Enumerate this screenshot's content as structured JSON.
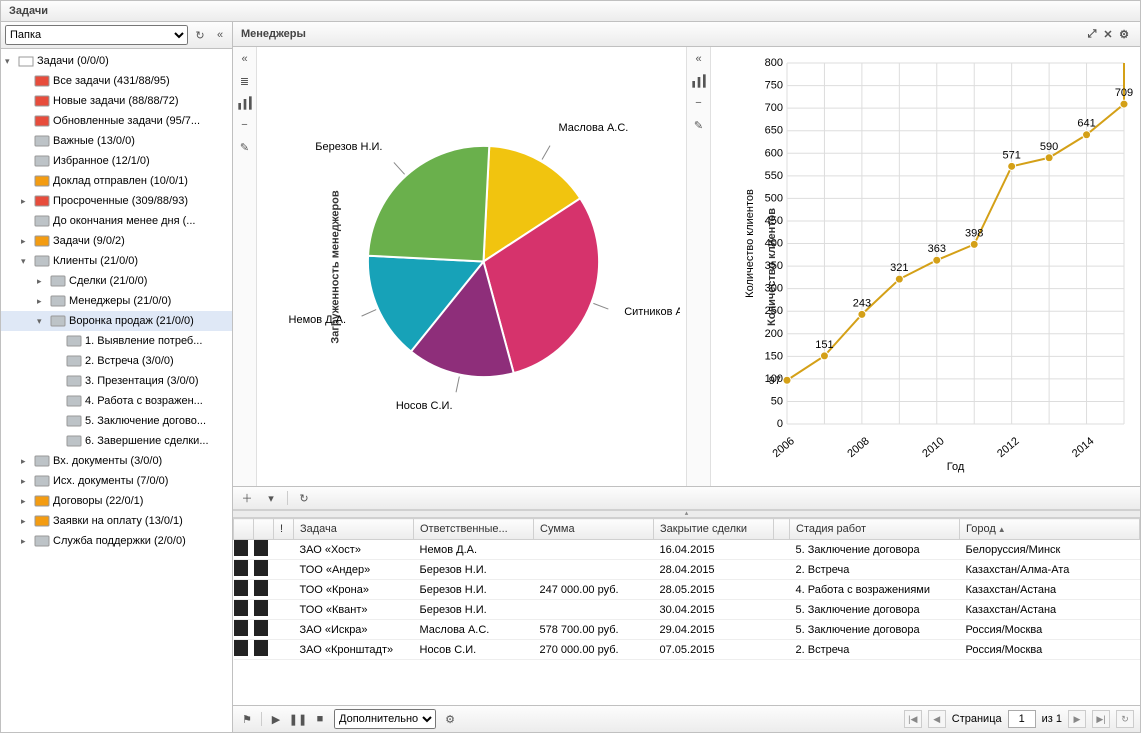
{
  "title": "Задачи",
  "sidebar": {
    "folder_select": "Папка",
    "root": {
      "label": "Задачи (0/0/0)"
    },
    "items": [
      {
        "icon": "red",
        "label": "Все задачи (431/88/95)",
        "indent": 1
      },
      {
        "icon": "red",
        "label": "Новые задачи (88/88/72)",
        "indent": 1
      },
      {
        "icon": "red",
        "label": "Обновленные задачи (95/7...",
        "indent": 1
      },
      {
        "icon": "grey",
        "label": "Важные (13/0/0)",
        "indent": 1
      },
      {
        "icon": "grey",
        "label": "Избранное (12/1/0)",
        "indent": 1
      },
      {
        "icon": "yellow",
        "label": "Доклад отправлен (10/0/1)",
        "indent": 1
      },
      {
        "icon": "red",
        "label": "Просроченные (309/88/93)",
        "indent": 1,
        "arrow": "collapsed"
      },
      {
        "icon": "grey",
        "label": "До окончания менее дня (...",
        "indent": 1
      },
      {
        "icon": "yellow",
        "label": "Задачи (9/0/2)",
        "indent": 1,
        "arrow": "collapsed"
      },
      {
        "icon": "grey",
        "label": "Клиенты (21/0/0)",
        "indent": 1,
        "arrow": "expanded"
      },
      {
        "icon": "grey",
        "label": "Сделки (21/0/0)",
        "indent": 2,
        "arrow": "collapsed"
      },
      {
        "icon": "grey",
        "label": "Менеджеры (21/0/0)",
        "indent": 2,
        "arrow": "collapsed"
      },
      {
        "icon": "grey",
        "label": "Воронка продаж (21/0/0)",
        "indent": 2,
        "arrow": "expanded",
        "selected": true
      },
      {
        "icon": "grey",
        "label": "1. Выявление потреб...",
        "indent": 3
      },
      {
        "icon": "grey",
        "label": "2. Встреча (3/0/0)",
        "indent": 3
      },
      {
        "icon": "grey",
        "label": "3. Презентация (3/0/0)",
        "indent": 3
      },
      {
        "icon": "grey",
        "label": "4. Работа с возражен...",
        "indent": 3
      },
      {
        "icon": "grey",
        "label": "5. Заключение догово...",
        "indent": 3
      },
      {
        "icon": "grey",
        "label": "6. Завершение сделки...",
        "indent": 3
      },
      {
        "icon": "grey",
        "label": "Вх. документы (3/0/0)",
        "indent": 1,
        "arrow": "collapsed"
      },
      {
        "icon": "grey",
        "label": "Исх. документы (7/0/0)",
        "indent": 1,
        "arrow": "collapsed"
      },
      {
        "icon": "yellow",
        "label": "Договоры (22/0/1)",
        "indent": 1,
        "arrow": "collapsed"
      },
      {
        "icon": "yellow",
        "label": "Заявки на оплату (13/0/1)",
        "indent": 1,
        "arrow": "collapsed"
      },
      {
        "icon": "grey",
        "label": "Служба поддержки (2/0/0)",
        "indent": 1,
        "arrow": "collapsed"
      }
    ]
  },
  "content": {
    "title": "Менеджеры"
  },
  "pie_vlabel": "Загруженность менеджеров",
  "line_vlabel": "Количество клиентов",
  "chart_data": [
    {
      "type": "pie",
      "title": "Загруженность менеджеров",
      "series": [
        {
          "name": "Маслова А.С.",
          "value": 15,
          "color": "#f1c40f"
        },
        {
          "name": "Ситников А.А.",
          "value": 30,
          "color": "#d6336c"
        },
        {
          "name": "Носов С.И.",
          "value": 15,
          "color": "#8e2e7a"
        },
        {
          "name": "Немов Д.А.",
          "value": 15,
          "color": "#17a2b8"
        },
        {
          "name": "Березов Н.И.",
          "value": 25,
          "color": "#6ab04c"
        }
      ]
    },
    {
      "type": "line",
      "title": "Количество клиентов",
      "xlabel": "Год",
      "ylabel": "Количество клиентов",
      "ylim": [
        0,
        800
      ],
      "x": [
        2006,
        2007,
        2008,
        2009,
        2010,
        2011,
        2012,
        2013,
        2014,
        2015
      ],
      "values": [
        97,
        151,
        243,
        321,
        363,
        398,
        571,
        590,
        641,
        709
      ],
      "line_color": "#d4a017"
    }
  ],
  "line_last_point": 800,
  "grid": {
    "columns": [
      "",
      "",
      "!",
      "Задача",
      "Ответственные...",
      "Сумма",
      "Закрытие сделки",
      "",
      "Стадия работ",
      "Город"
    ],
    "sort_col": 9,
    "rows": [
      {
        "task": "ЗАО «Хост»",
        "resp": "Немов Д.А.",
        "sum": "",
        "close": "16.04.2015",
        "stage": "5. Заключение договора",
        "city": "Белоруссия/Минск"
      },
      {
        "task": "ТОО «Андер»",
        "resp": "Березов Н.И.",
        "sum": "",
        "close": "28.04.2015",
        "stage": "2. Встреча",
        "city": "Казахстан/Алма-Ата"
      },
      {
        "task": "ТОО «Крона»",
        "resp": "Березов Н.И.",
        "sum": "247 000.00 руб.",
        "close": "28.05.2015",
        "stage": "4. Работа с возражениями",
        "city": "Казахстан/Астана"
      },
      {
        "task": "ТОО «Квант»",
        "resp": "Березов Н.И.",
        "sum": "",
        "close": "30.04.2015",
        "stage": "5. Заключение договора",
        "city": "Казахстан/Астана"
      },
      {
        "task": "ЗАО «Искра»",
        "resp": "Маслова А.С.",
        "sum": "578 700.00 руб.",
        "close": "29.04.2015",
        "stage": "5. Заключение договора",
        "city": "Россия/Москва"
      },
      {
        "task": "ЗАО «Кронштадт»",
        "resp": "Носов С.И.",
        "sum": "270 000.00 руб.",
        "close": "07.05.2015",
        "stage": "2. Встреча",
        "city": "Россия/Москва"
      }
    ]
  },
  "footer": {
    "extra_select": "Дополнительно",
    "page_label": "Страница",
    "page_current": "1",
    "page_of": "из 1"
  }
}
